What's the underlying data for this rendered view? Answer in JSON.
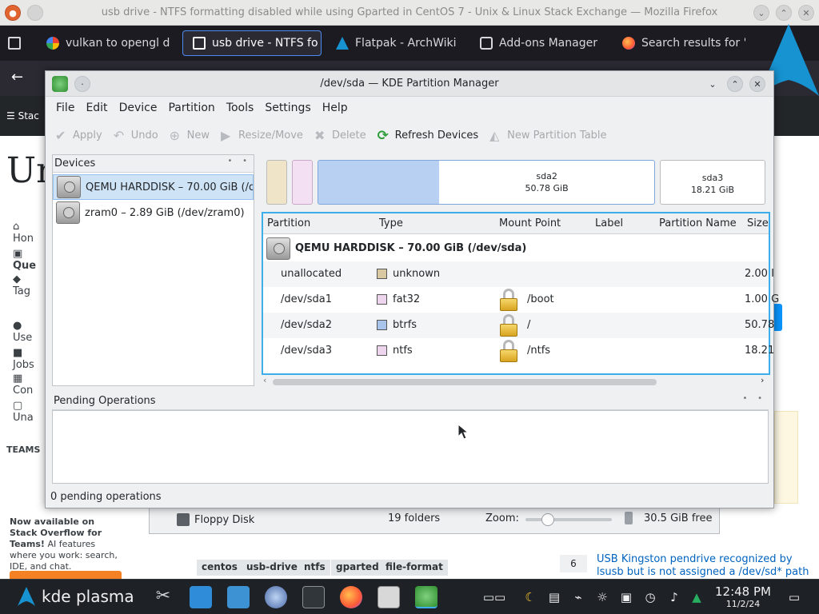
{
  "firefox": {
    "title": "usb drive - NTFS formatting disabled while using Gparted in CentOS 7 - Unix & Linux Stack Exchange — Mozilla Firefox",
    "tabs": [
      {
        "label": "vulkan to opengl d",
        "icon": "google-icon"
      },
      {
        "label": "usb drive - NTFS fo",
        "icon": "stackexchange-icon"
      },
      {
        "label": "Flatpak - ArchWiki",
        "icon": "archlinux-icon"
      },
      {
        "label": "Add-ons Manager",
        "icon": "puzzle-icon"
      },
      {
        "label": "Search results for '",
        "icon": "firefox-icon"
      }
    ]
  },
  "stackpage": {
    "sidebar": [
      "Hon",
      "Que",
      "Tag",
      "Use",
      "Jobs",
      "Con",
      "Una"
    ],
    "logo_partial": "Un",
    "teams_header": "TEAMS",
    "teams_title": "Now available on Stack Overflow for Teams!",
    "teams_text": "AI features where you work: search, IDE, and chat.",
    "tags": [
      "centos",
      "usb-drive",
      "ntfs",
      "gparted",
      "file-format"
    ],
    "related_count": "6",
    "related_title": "USB Kingston pendrive recognized by lsusb but is not assigned a /dev/sd* path"
  },
  "kde": {
    "title": "/dev/sda — KDE Partition Manager",
    "menu": [
      "File",
      "Edit",
      "Device",
      "Partition",
      "Tools",
      "Settings",
      "Help"
    ],
    "toolbar": [
      {
        "label": "Apply",
        "enabled": false,
        "icon": "check-icon"
      },
      {
        "label": "Undo",
        "enabled": false,
        "icon": "undo-icon"
      },
      {
        "label": "New",
        "enabled": false,
        "icon": "new-icon"
      },
      {
        "label": "Resize/Move",
        "enabled": false,
        "icon": "resize-icon"
      },
      {
        "label": "Delete",
        "enabled": false,
        "icon": "delete-icon"
      },
      {
        "label": "Refresh Devices",
        "enabled": true,
        "icon": "refresh-icon"
      },
      {
        "label": "New Partition Table",
        "enabled": false,
        "icon": "partition-table-icon"
      }
    ],
    "devices_header": "Devices",
    "devices": [
      {
        "label": "QEMU HARDDISK – 70.00 GiB (/d...",
        "selected": true
      },
      {
        "label": "zram0 – 2.89 GiB (/dev/zram0)",
        "selected": false
      }
    ],
    "graph": [
      {
        "name": "",
        "size": "",
        "color": "#efe4c7"
      },
      {
        "name": "",
        "size": "",
        "color": "#f3e1f3"
      },
      {
        "name": "sda2",
        "size": "50.78 GiB",
        "color": "#b8d0f2"
      },
      {
        "name": "sda3",
        "size": "18.21 GiB",
        "color": "#ffffff"
      }
    ],
    "columns": [
      "Partition",
      "Type",
      "Mount Point",
      "Label",
      "Partition Name",
      "Size"
    ],
    "disk_row": "QEMU HARDDISK – 70.00 GiB (/dev/sda)",
    "partitions": [
      {
        "name": "unallocated",
        "type": "unknown",
        "color": "#d9c9a2",
        "mount": "",
        "locked": false,
        "size": "2.00 I"
      },
      {
        "name": "/dev/sda1",
        "type": "fat32",
        "color": "#eed5ee",
        "mount": "/boot",
        "locked": true,
        "size": "1.00 G"
      },
      {
        "name": "/dev/sda2",
        "type": "btrfs",
        "color": "#a8c4ea",
        "mount": "/",
        "locked": true,
        "size": "50.78"
      },
      {
        "name": "/dev/sda3",
        "type": "ntfs",
        "color": "#eed5ee",
        "mount": "/ntfs",
        "locked": true,
        "size": "18.21"
      }
    ],
    "pending_header": "Pending Operations",
    "status": "0 pending operations"
  },
  "dolphin": {
    "place": "Floppy Disk",
    "folders": "19 folders",
    "zoom_label": "Zoom:",
    "free": "30.5 GiB free"
  },
  "taskbar": {
    "launcher": "kde plasma",
    "time": "12:48 PM",
    "date": "11/2/24"
  }
}
